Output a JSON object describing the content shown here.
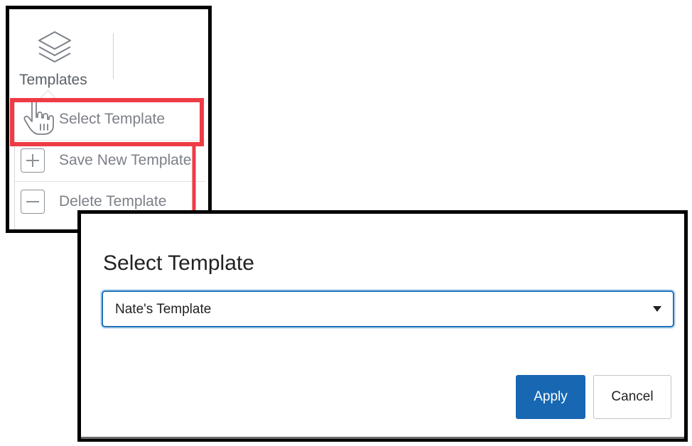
{
  "menu": {
    "templates_label": "Templates",
    "icons": {
      "templates": "layers-icon",
      "select": "hand-pointer-icon",
      "save": "plus-square-icon",
      "delete": "minus-square-icon"
    },
    "items": [
      {
        "label": "Select Template",
        "highlighted": true
      },
      {
        "label": "Save New Template"
      },
      {
        "label": "Delete Template"
      }
    ]
  },
  "dialog": {
    "title": "Select Template",
    "select": {
      "selected_value": "Nate's Template"
    },
    "apply_label": "Apply",
    "cancel_label": "Cancel"
  },
  "colors": {
    "highlight": "#ef3b45",
    "primary_button": "#1767b3",
    "select_focus_border": "#1d73bb",
    "menu_text": "#7c8087",
    "frame_border": "#000000"
  }
}
